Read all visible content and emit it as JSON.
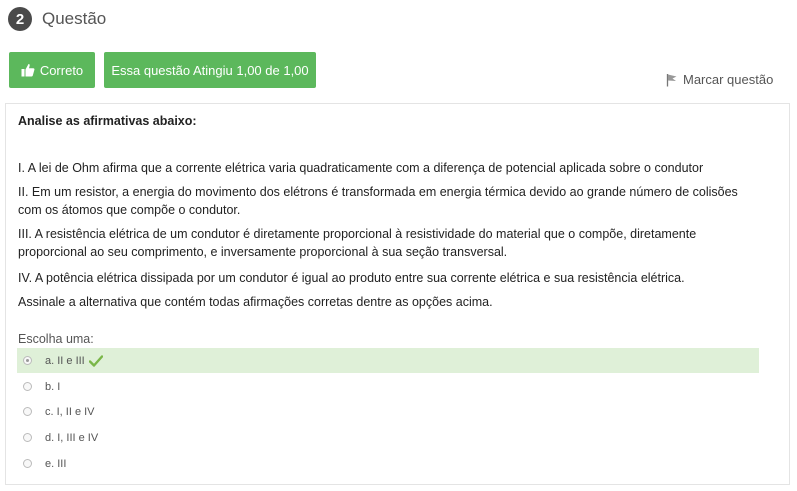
{
  "header": {
    "number": "2",
    "title": "Questão"
  },
  "status": {
    "correct_label": "Correto",
    "grade_label": "Essa questão Atingiu 1,00 de 1,00"
  },
  "flag": {
    "label": "Marcar questão"
  },
  "question": {
    "intro": "Analise as afirmativas abaixo:",
    "statements": [
      "I. A lei de Ohm afirma que a corrente elétrica varia quadraticamente com a diferença de potencial aplicada sobre o condutor",
      "II. Em um resistor, a energia do movimento dos elétrons é transformada em energia térmica devido ao grande número de colisões com os átomos que compõe o condutor.",
      "III. A resistência elétrica de um condutor é diretamente proporcional à resistividade do material que o compõe, diretamente proporcional ao seu comprimento, e inversamente proporcional à sua seção transversal.",
      "IV. A potência elétrica dissipada por um condutor é igual ao produto entre sua corrente elétrica e sua resistência elétrica."
    ],
    "prompt": "Assinale a alternativa que contém todas afirmações corretas dentre as opções acima.",
    "choose_label": "Escolha uma:",
    "options": [
      {
        "label": "a. II e III",
        "selected": true,
        "correct": true
      },
      {
        "label": "b. I",
        "selected": false,
        "correct": false
      },
      {
        "label": "c. I, II e IV",
        "selected": false,
        "correct": false
      },
      {
        "label": "d. I, III e IV",
        "selected": false,
        "correct": false
      },
      {
        "label": "e. III",
        "selected": false,
        "correct": false
      }
    ]
  },
  "colors": {
    "accent_green": "#5cb85c",
    "selected_bg": "#dff0d8",
    "check_green": "#7ab648"
  },
  "icons": {
    "thumb": "thumbs-up-icon",
    "flag": "flag-icon",
    "check": "checkmark-icon"
  }
}
